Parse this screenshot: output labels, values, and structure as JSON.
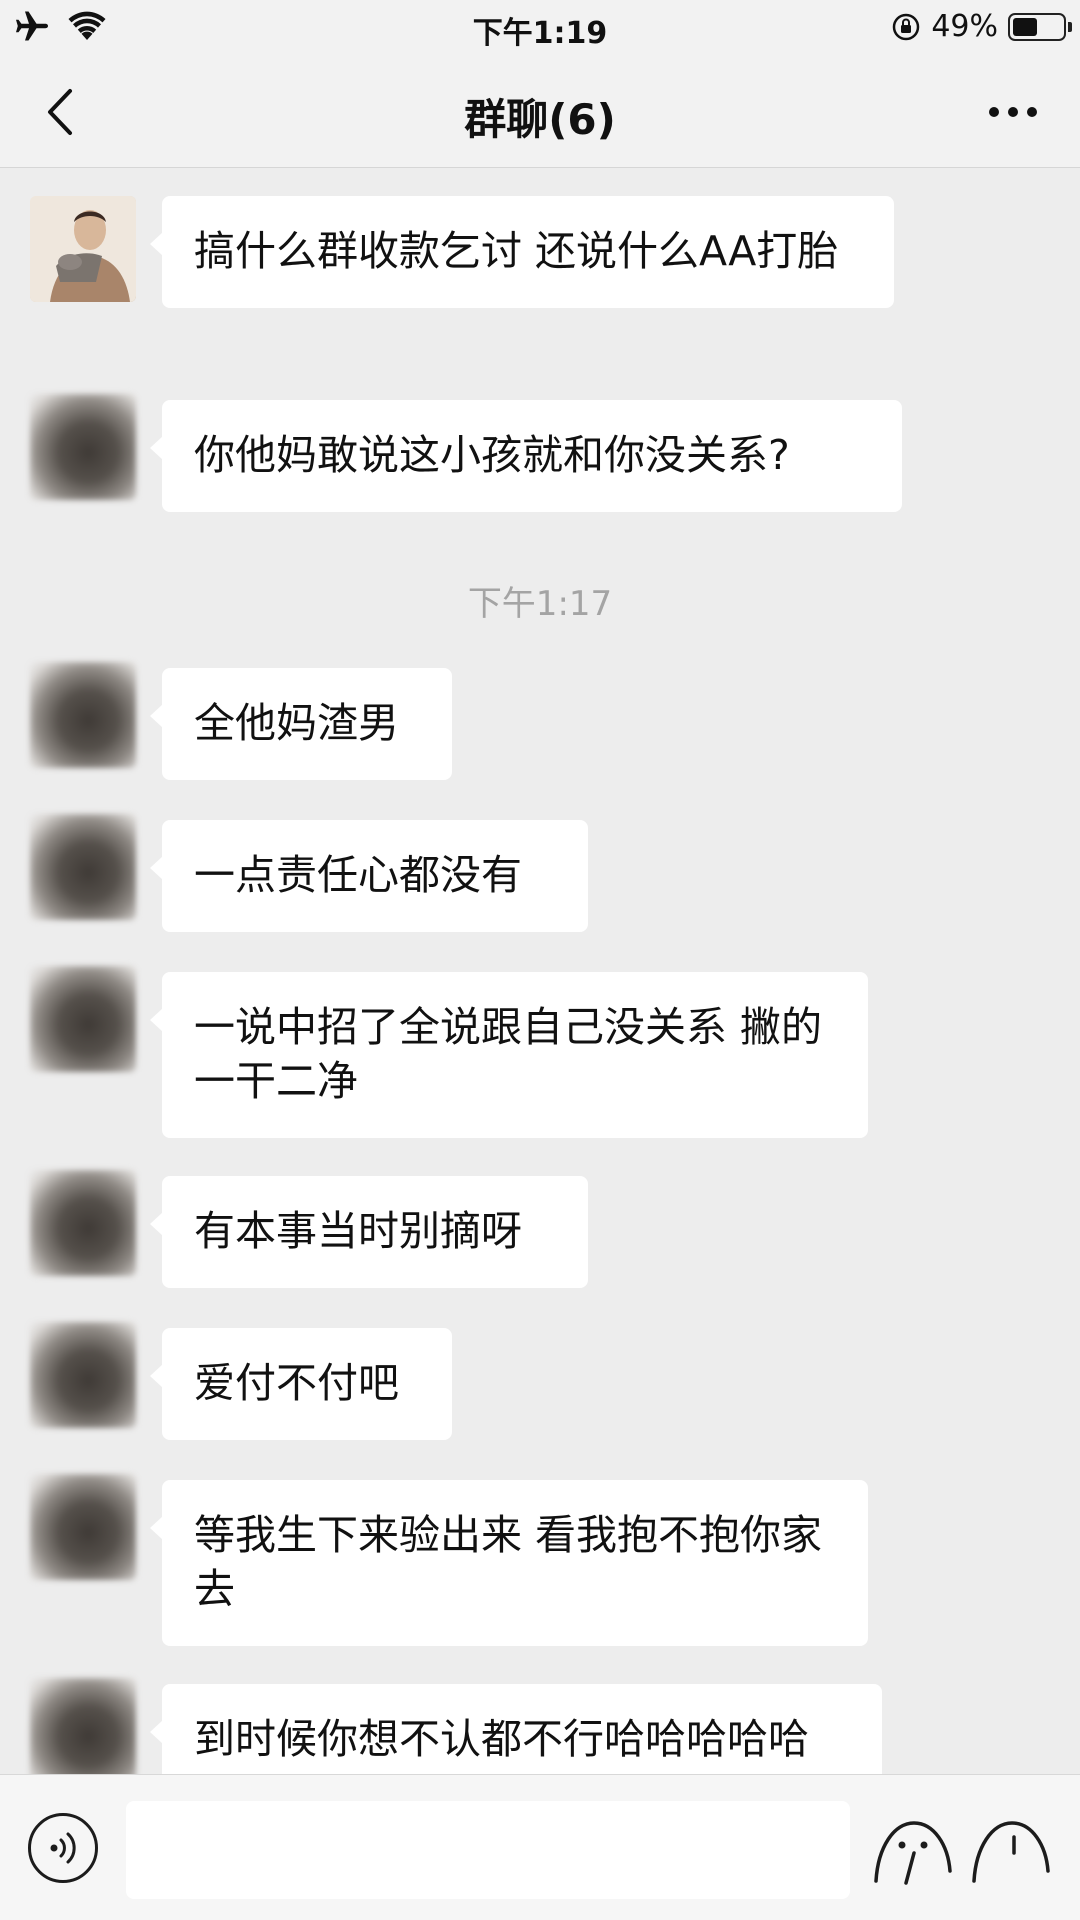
{
  "status_bar": {
    "time": "下午1:19",
    "battery_pct_label": "49%",
    "battery_level": 0.49
  },
  "nav": {
    "title": "群聊(6)"
  },
  "timestamp": "下午1:17",
  "messages": [
    {
      "text": "搞什么群收款乞讨  还说什么AA打胎"
    },
    {
      "text": "你他妈敢说这小孩就和你没关系?"
    },
    {
      "text": "全他妈渣男"
    },
    {
      "text": "一点责任心都没有"
    },
    {
      "text": "一说中招了全说跟自己没关系 撇的一干二净"
    },
    {
      "text": "有本事当时别摘呀"
    },
    {
      "text": "爱付不付吧"
    },
    {
      "text": "等我生下来验出来 看我抱不抱你家去"
    },
    {
      "text": "到时候你想不认都不行哈哈哈哈哈"
    }
  ],
  "input": {
    "value": "",
    "placeholder": ""
  },
  "icons": {
    "back": "chevron-left-icon",
    "more": "more-dots-icon",
    "voice": "voice-icon",
    "emoji": "emoji-icon",
    "plus": "plus-icon"
  }
}
